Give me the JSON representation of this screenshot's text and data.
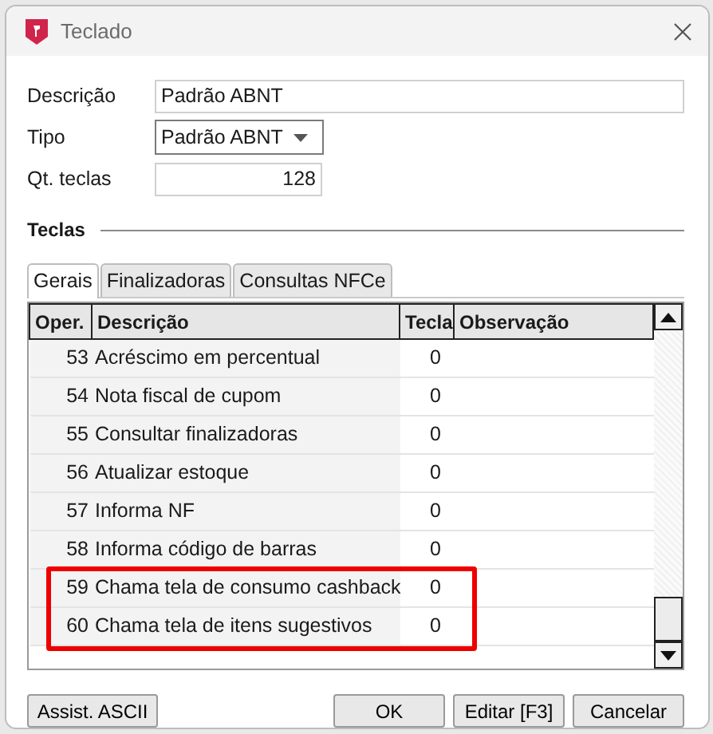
{
  "window": {
    "title": "Teclado"
  },
  "form": {
    "descricao_label": "Descrição",
    "descricao_value": "Padrão ABNT",
    "tipo_label": "Tipo",
    "tipo_value": "Padrão ABNT",
    "qt_label": "Qt. teclas",
    "qt_value": "128"
  },
  "section_title": "Teclas",
  "tabs": [
    {
      "label": "Gerais",
      "selected": true
    },
    {
      "label": "Finalizadoras",
      "selected": false
    },
    {
      "label": "Consultas NFCe",
      "selected": false
    }
  ],
  "table": {
    "columns": [
      "Oper.",
      "Descrição",
      "Tecla",
      "Observação"
    ],
    "rows": [
      {
        "oper": "53",
        "descricao": "Acréscimo em percentual",
        "tecla": "0",
        "highlighted": false
      },
      {
        "oper": "54",
        "descricao": "Nota fiscal de cupom",
        "tecla": "0",
        "highlighted": false
      },
      {
        "oper": "55",
        "descricao": "Consultar finalizadoras",
        "tecla": "0",
        "highlighted": false
      },
      {
        "oper": "56",
        "descricao": "Atualizar estoque",
        "tecla": "0",
        "highlighted": false
      },
      {
        "oper": "57",
        "descricao": "Informa NF",
        "tecla": "0",
        "highlighted": false
      },
      {
        "oper": "58",
        "descricao": "Informa código de barras",
        "tecla": "0",
        "highlighted": false
      },
      {
        "oper": "59",
        "descricao": "Chama tela de consumo cashback",
        "tecla": "0",
        "highlighted": true
      },
      {
        "oper": "60",
        "descricao": "Chama tela de itens sugestivos",
        "tecla": "0",
        "highlighted": true
      }
    ]
  },
  "buttons": {
    "left": [
      "Assist. ASCII"
    ],
    "right": [
      "OK",
      "Editar [F3]",
      "Cancelar"
    ]
  }
}
